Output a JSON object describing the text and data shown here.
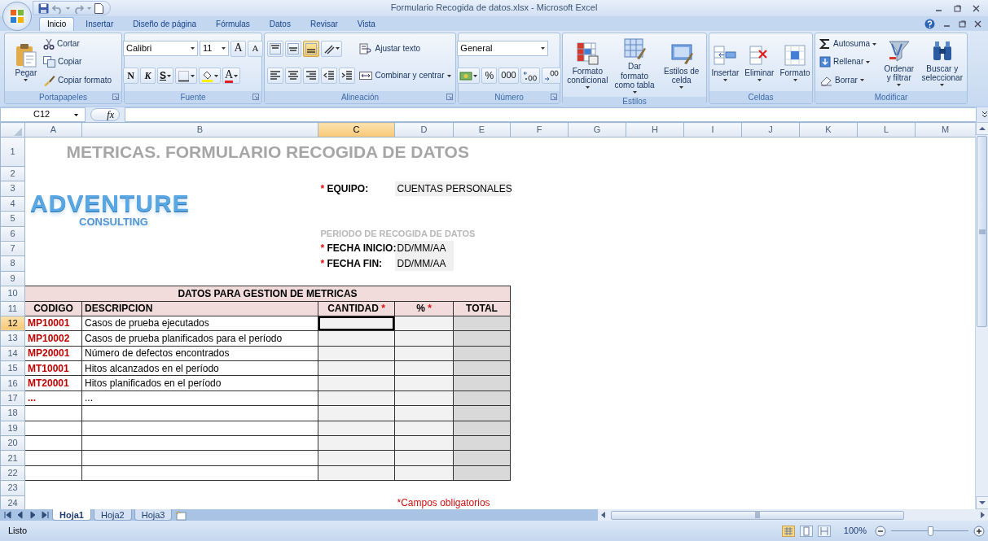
{
  "window": {
    "title": "Formulario Recogida de datos.xlsx - Microsoft Excel"
  },
  "tabs": [
    {
      "label": "Inicio",
      "selected": true
    },
    {
      "label": "Insertar",
      "selected": false
    },
    {
      "label": "Diseño de página",
      "selected": false
    },
    {
      "label": "Fórmulas",
      "selected": false
    },
    {
      "label": "Datos",
      "selected": false
    },
    {
      "label": "Revisar",
      "selected": false
    },
    {
      "label": "Vista",
      "selected": false
    }
  ],
  "ribbon": [
    {
      "label": "Portapapeles",
      "launcher": true,
      "columns": [
        [
          [
            {
              "kind": "large",
              "label": "Pegar",
              "dropdown": true
            }
          ]
        ],
        [
          [
            {
              "kind": "small",
              "label": "Cortar",
              "dropdown": false
            }
          ],
          [
            {
              "kind": "small",
              "label": "Copiar",
              "dropdown": false
            }
          ],
          [
            {
              "kind": "small",
              "label": "Copiar formato",
              "dropdown": false
            }
          ]
        ]
      ]
    },
    {
      "label": "Fuente",
      "launcher": true,
      "columns": [
        [
          [
            {
              "kind": "field",
              "value": "Calibri"
            },
            {
              "kind": "field",
              "value": "11"
            },
            {
              "kind": "letter",
              "label": "A",
              "dropdown": false
            },
            {
              "kind": "letter",
              "label": "A",
              "dropdown": false
            }
          ],
          [
            {
              "kind": "letter",
              "label": "N",
              "dropdown": false
            },
            {
              "kind": "letter",
              "label": "K",
              "dropdown": false
            },
            {
              "kind": "letter",
              "label": "S",
              "dropdown": true
            },
            {
              "kind": "icon",
              "dropdown": true
            },
            {
              "kind": "icon",
              "dropdown": true
            },
            {
              "kind": "letter",
              "label": "A",
              "dropdown": true
            }
          ]
        ]
      ]
    },
    {
      "label": "Alineación",
      "launcher": true,
      "columns": [
        [
          [
            {
              "kind": "toggle",
              "on": false,
              "dropdown": false
            },
            {
              "kind": "toggle",
              "on": false,
              "dropdown": false
            },
            {
              "kind": "toggle",
              "on": true,
              "dropdown": false
            },
            {
              "kind": "icon",
              "dropdown": true
            }
          ],
          [
            {
              "kind": "toggle",
              "on": false,
              "dropdown": false
            },
            {
              "kind": "toggle",
              "on": false,
              "dropdown": false
            },
            {
              "kind": "toggle",
              "on": false,
              "dropdown": false
            },
            {
              "kind": "icon",
              "dropdown": false
            },
            {
              "kind": "icon",
              "dropdown": false
            }
          ]
        ],
        [
          [
            {
              "kind": "small",
              "label": "Ajustar texto",
              "dropdown": false
            }
          ],
          [
            {
              "kind": "small",
              "label": "Combinar y centrar",
              "dropdown": true
            }
          ]
        ]
      ]
    },
    {
      "label": "Número",
      "launcher": true,
      "columns": [
        [
          [
            {
              "kind": "field",
              "value": "General"
            }
          ],
          [
            {
              "kind": "icon",
              "dropdown": true
            },
            {
              "kind": "letter",
              "label": "%",
              "dropdown": false
            },
            {
              "kind": "letter",
              "label": "000",
              "dropdown": false
            },
            {
              "kind": "icon",
              "dropdown": false
            },
            {
              "kind": "icon",
              "dropdown": false
            }
          ]
        ]
      ]
    },
    {
      "label": "Estilos",
      "launcher": false,
      "columns": [
        [
          [
            {
              "kind": "large",
              "label": "Formato condicional",
              "dropdown": true
            }
          ]
        ],
        [
          [
            {
              "kind": "large",
              "label": "Dar formato como tabla",
              "dropdown": true
            }
          ]
        ],
        [
          [
            {
              "kind": "large",
              "label": "Estilos de celda",
              "dropdown": true
            }
          ]
        ]
      ]
    },
    {
      "label": "Celdas",
      "launcher": false,
      "columns": [
        [
          [
            {
              "kind": "large",
              "label": "Insertar",
              "dropdown": true
            }
          ]
        ],
        [
          [
            {
              "kind": "large",
              "label": "Eliminar",
              "dropdown": true
            }
          ]
        ],
        [
          [
            {
              "kind": "large",
              "label": "Formato",
              "dropdown": true
            }
          ]
        ]
      ]
    },
    {
      "label": "Modificar",
      "launcher": false,
      "columns": [
        [
          [
            {
              "kind": "small",
              "label": "Autosuma",
              "dropdown": true
            }
          ],
          [
            {
              "kind": "small",
              "label": "Rellenar",
              "dropdown": true
            }
          ],
          [
            {
              "kind": "small",
              "label": "Borrar",
              "dropdown": true
            }
          ]
        ],
        [
          [
            {
              "kind": "large",
              "label": "Ordenar y filtrar",
              "dropdown": true
            }
          ]
        ],
        [
          [
            {
              "kind": "large",
              "label": "Buscar y seleccionar",
              "dropdown": true
            }
          ]
        ]
      ]
    }
  ],
  "formula_bar": {
    "name_box": "C12",
    "function_label": "fx"
  },
  "columns": [
    {
      "label": "A",
      "selected": false
    },
    {
      "label": "B",
      "selected": false
    },
    {
      "label": "C",
      "selected": true
    },
    {
      "label": "D",
      "selected": false
    },
    {
      "label": "E",
      "selected": false
    },
    {
      "label": "F",
      "selected": false
    },
    {
      "label": "G",
      "selected": false
    },
    {
      "label": "H",
      "selected": false
    },
    {
      "label": "I",
      "selected": false
    },
    {
      "label": "J",
      "selected": false
    },
    {
      "label": "K",
      "selected": false
    },
    {
      "label": "L",
      "selected": false
    },
    {
      "label": "M",
      "selected": false
    }
  ],
  "rows": [
    {
      "label": "1",
      "selected": false
    },
    {
      "label": "2",
      "selected": false
    },
    {
      "label": "3",
      "selected": false
    },
    {
      "label": "4",
      "selected": false
    },
    {
      "label": "5",
      "selected": false
    },
    {
      "label": "6",
      "selected": false
    },
    {
      "label": "7",
      "selected": false
    },
    {
      "label": "8",
      "selected": false
    },
    {
      "label": "9",
      "selected": false
    },
    {
      "label": "10",
      "selected": false
    },
    {
      "label": "11",
      "selected": false
    },
    {
      "label": "12",
      "selected": true
    },
    {
      "label": "13",
      "selected": false
    },
    {
      "label": "14",
      "selected": false
    },
    {
      "label": "15",
      "selected": false
    },
    {
      "label": "16",
      "selected": false
    },
    {
      "label": "17",
      "selected": false
    },
    {
      "label": "18",
      "selected": false
    },
    {
      "label": "19",
      "selected": false
    },
    {
      "label": "20",
      "selected": false
    },
    {
      "label": "21",
      "selected": false
    },
    {
      "label": "22",
      "selected": false
    },
    {
      "label": "23",
      "selected": false
    },
    {
      "label": "24",
      "selected": false
    }
  ],
  "sheet": {
    "title": "METRICAS. FORMULARIO RECOGIDA DE DATOS",
    "logo": {
      "line_1": "ADVENTURE",
      "line_2": "CONSULTING"
    },
    "team": {
      "mark": "*",
      "label": "EQUIPO:",
      "value": "CUENTAS PERSONALES"
    },
    "period_heading": "PERIODO DE RECOGIDA DE DATOS",
    "dates": [
      {
        "mark": "*",
        "label": "FECHA INICIO:",
        "value": "DD/MM/AA"
      },
      {
        "mark": "*",
        "label": "FECHA FIN:",
        "value": "DD/MM/AA"
      }
    ],
    "table": {
      "title": "DATOS PARA GESTION DE METRICAS",
      "columns": [
        {
          "label": "CODIGO"
        },
        {
          "label": "DESCRIPCION"
        },
        {
          "label": "CANTIDAD",
          "mark": "*"
        },
        {
          "label": "%",
          "mark": "*"
        },
        {
          "label": "TOTAL"
        }
      ],
      "rows": [
        {
          "code": "MP10001",
          "description": "Casos de prueba ejecutados",
          "selected": true
        },
        {
          "code": "MP10002",
          "description": "Casos de prueba planificados para el período",
          "selected": false
        },
        {
          "code": "MP20001",
          "description": "Número de defectos encontrados",
          "selected": false
        },
        {
          "code": "MT10001",
          "description": "Hitos alcanzados en el período",
          "selected": false
        },
        {
          "code": "MT20001",
          "description": "Hitos planificados en el período",
          "selected": false
        },
        {
          "code": "...",
          "description": "...",
          "selected": false
        },
        {
          "selected": false
        },
        {
          "selected": false
        },
        {
          "selected": false
        },
        {
          "selected": false
        },
        {
          "selected": false
        }
      ]
    },
    "footnote": "*Campos obligatorios"
  },
  "sheet_tabs": [
    {
      "label": "Hoja1",
      "selected": true
    },
    {
      "label": "Hoja2",
      "selected": false
    },
    {
      "label": "Hoja3",
      "selected": false
    }
  ],
  "status_bar": {
    "text": "Listo",
    "views": [
      {
        "selected": true
      },
      {
        "selected": false
      },
      {
        "selected": false
      }
    ],
    "zoom": {
      "label": "100%",
      "level": 0.5
    }
  }
}
